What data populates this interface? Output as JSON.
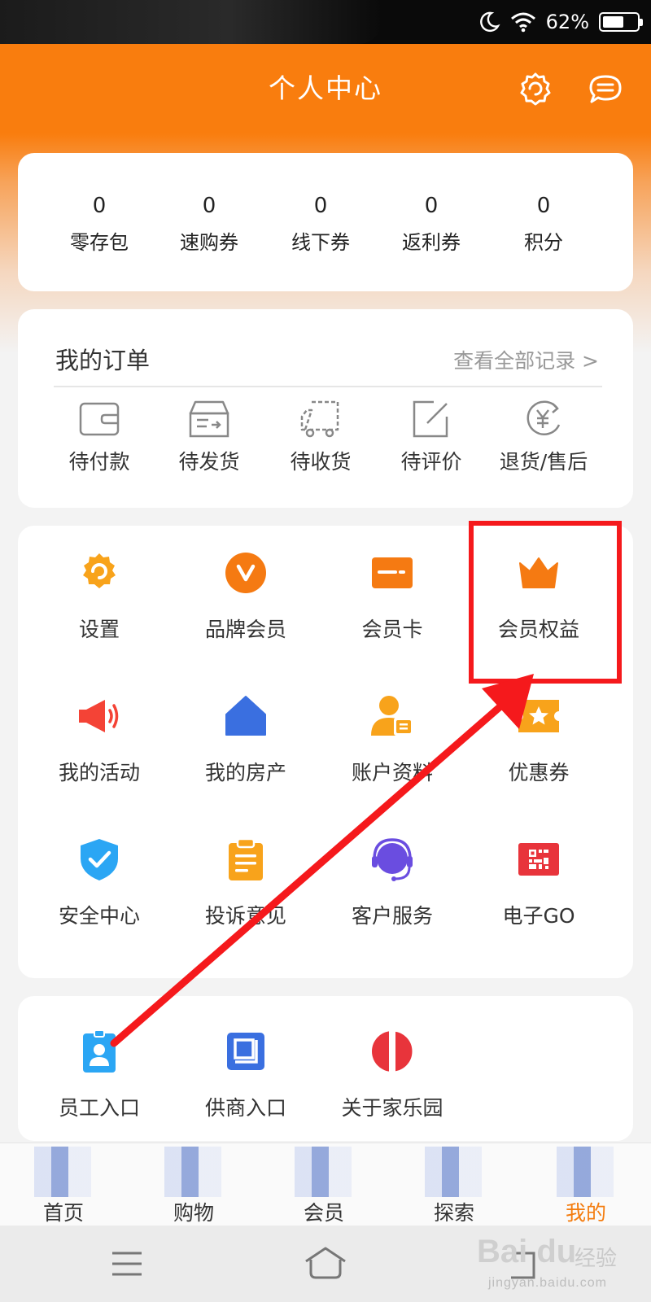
{
  "status_bar": {
    "battery": "62%",
    "battery_level": 0.62,
    "icons": [
      "moon-icon",
      "wifi-icon",
      "battery-icon"
    ]
  },
  "header": {
    "title": "个人中心",
    "icons": [
      "settings-icon",
      "message-icon"
    ]
  },
  "assets": [
    {
      "value": "0",
      "label": "零存包"
    },
    {
      "value": "0",
      "label": "速购券"
    },
    {
      "value": "0",
      "label": "线下券"
    },
    {
      "value": "0",
      "label": "返利券"
    },
    {
      "value": "0",
      "label": "积分"
    }
  ],
  "orders": {
    "title": "我的订单",
    "view_all": "查看全部记录 >",
    "items": [
      {
        "label": "待付款",
        "icon": "wallet-icon"
      },
      {
        "label": "待发货",
        "icon": "box-icon"
      },
      {
        "label": "待收货",
        "icon": "truck-icon"
      },
      {
        "label": "待评价",
        "icon": "edit-icon"
      },
      {
        "label": "退货/售后",
        "icon": "refund-icon"
      }
    ]
  },
  "services": [
    {
      "label": "设置",
      "icon": "gear-icon"
    },
    {
      "label": "品牌会员",
      "icon": "brand-vip-icon"
    },
    {
      "label": "会员卡",
      "icon": "member-card-icon"
    },
    {
      "label": "会员权益",
      "icon": "crown-icon"
    },
    {
      "label": "我的活动",
      "icon": "megaphone-icon"
    },
    {
      "label": "我的房产",
      "icon": "house-icon"
    },
    {
      "label": "账户资料",
      "icon": "profile-icon"
    },
    {
      "label": "优惠券",
      "icon": "coupon-icon"
    },
    {
      "label": "安全中心",
      "icon": "shield-icon"
    },
    {
      "label": "投诉意见",
      "icon": "clipboard-icon"
    },
    {
      "label": "客户服务",
      "icon": "headset-icon"
    },
    {
      "label": "电子GO",
      "icon": "qrcode-icon"
    }
  ],
  "other": [
    {
      "label": "员工入口",
      "icon": "employee-badge-icon"
    },
    {
      "label": "供商入口",
      "icon": "supplier-icon"
    },
    {
      "label": "关于家乐园",
      "icon": "about-logo-icon"
    }
  ],
  "tabbar": [
    {
      "label": "首页",
      "active": false
    },
    {
      "label": "购物",
      "active": false
    },
    {
      "label": "会员",
      "active": false
    },
    {
      "label": "探索",
      "active": false
    },
    {
      "label": "我的",
      "active": true
    }
  ],
  "colors": {
    "brand_orange": "#f97d0e",
    "highlight_red": "#f5191c",
    "active_tab": "#f47c0e"
  },
  "watermark": {
    "brand": "Bai du",
    "sub": "经验",
    "url": "jingyan.baidu.com"
  }
}
